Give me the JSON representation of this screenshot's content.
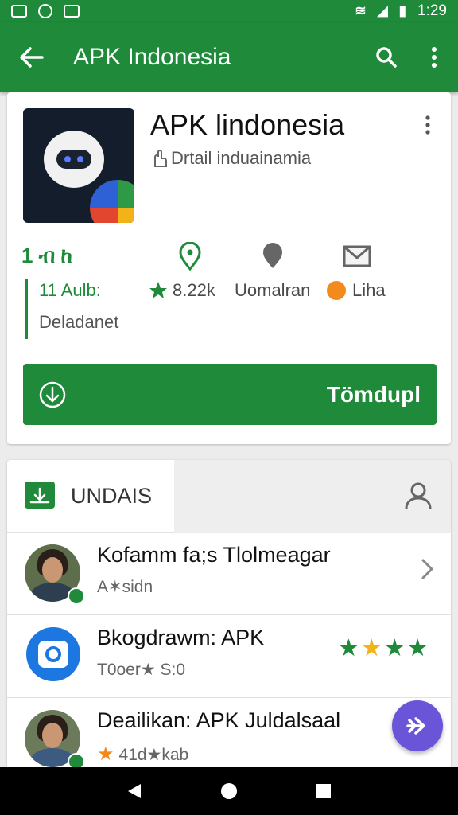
{
  "status_bar": {
    "time": "1:29",
    "left_icons": [
      "image-icon",
      "whatsapp-icon",
      "gamepad-icon"
    ],
    "right_icons": [
      "wifi-icon",
      "signal-icon",
      "battery-icon"
    ]
  },
  "app_bar": {
    "title": "APK Indonesia",
    "back_icon": "arrow-back-icon",
    "search_icon": "search-icon",
    "menu_icon": "more-vert-icon"
  },
  "app_card": {
    "name": "APK lindonesia",
    "subtitle": "Drtail induainamia",
    "stats": {
      "glyph": "1 ብ ከ",
      "downloads": "11 Aulb:",
      "downloads_caption": "Deladanet",
      "rating": "8.22k",
      "location": "Uomalran",
      "like": "Liha"
    },
    "download_button": "Tömdupl"
  },
  "section": {
    "title": "UNDAIS",
    "rows": [
      {
        "title": "Kofamm fa;s Tlolmeagar",
        "subtitle": "A✶sidn"
      },
      {
        "title": "Bkogdrawm: APK",
        "subtitle": "T0oer★ S:0",
        "stars": 4
      },
      {
        "title": "Deailikan: APK Juldalsaal",
        "subtitle": "41d★kab"
      }
    ]
  },
  "colors": {
    "primary": "#1e8a3a",
    "fab": "#6a55d8",
    "star_green": "#1e8a3a",
    "star_gold": "#f2b21a"
  }
}
